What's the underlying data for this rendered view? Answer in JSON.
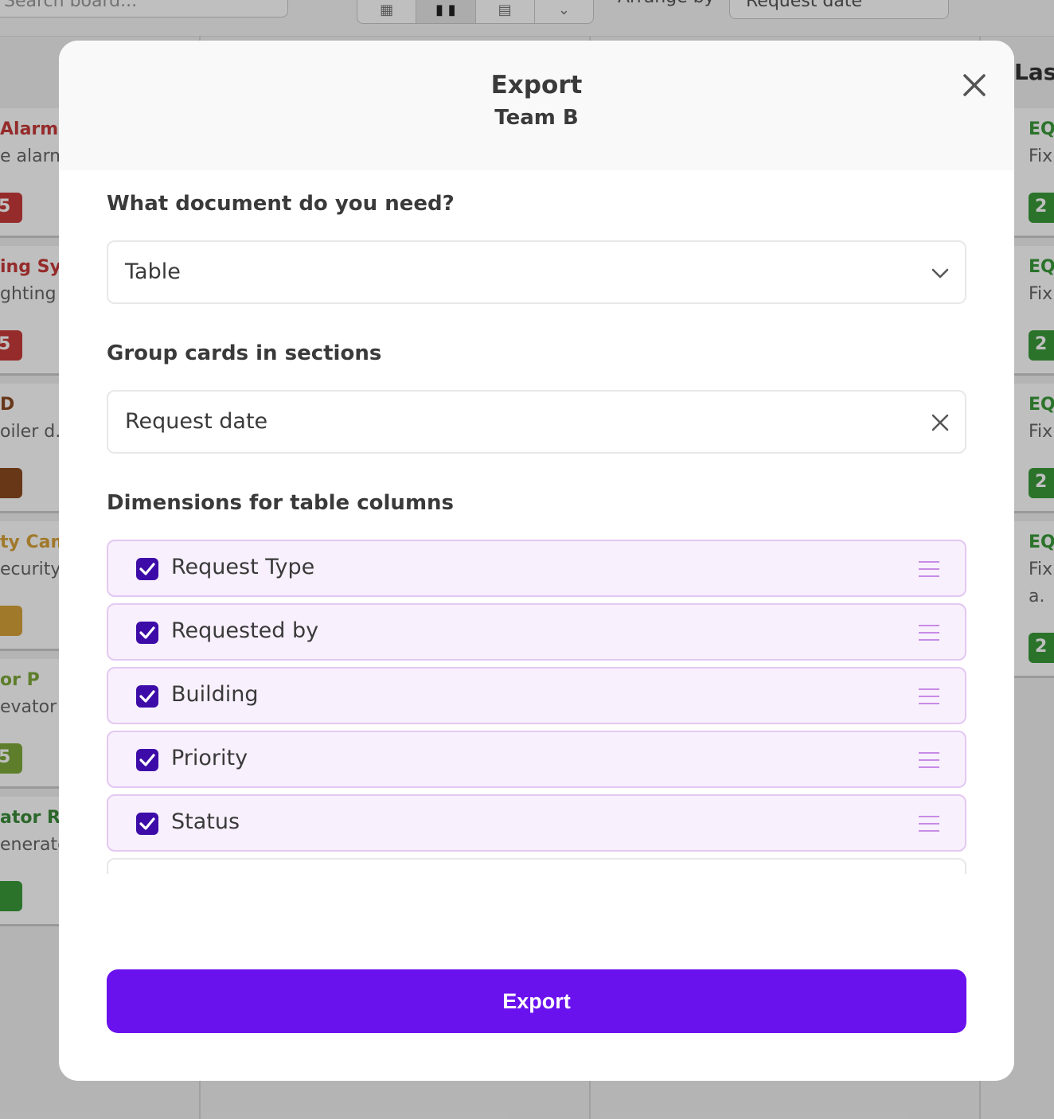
{
  "background": {
    "search_placeholder": "Search board...",
    "arrange_label": "Arrange by",
    "arrange_value": "Request date",
    "right_column_header": "Last",
    "left_cards": [
      {
        "title": "Alarm R",
        "sub": "e alarm",
        "badge": "5",
        "title_color": "#c73a3a",
        "badge_color": "#c73a3a"
      },
      {
        "title": "ing Syst",
        "sub": "ghting s",
        "badge": "5",
        "title_color": "#c73a3a",
        "badge_color": "#c73a3a"
      },
      {
        "title": "D",
        "sub": "oiler d.",
        "badge": "",
        "title_color": "#8a4a20",
        "badge_color": "#8a4a20"
      },
      {
        "title": "ty Cam",
        "sub": "ecurity c",
        "badge": "",
        "title_color": "#d6a23a",
        "badge_color": "#d6a23a"
      },
      {
        "title": "or P",
        "sub": "evator p",
        "badge": "5",
        "title_color": "#7ea83a",
        "badge_color": "#7ea83a"
      },
      {
        "title": "ator R",
        "sub": "enerato",
        "badge": "",
        "title_color": "#3a8a3a",
        "badge_color": "#3a9a3a"
      }
    ],
    "right_cards": [
      {
        "title": "EQ",
        "sub": "Fix",
        "sub2": "",
        "badge": "2"
      },
      {
        "title": "EQ",
        "sub": "Fix",
        "sub2": "",
        "badge": "2"
      },
      {
        "title": "EQ",
        "sub": "Fix",
        "sub2": "",
        "badge": "2"
      },
      {
        "title": "EQ",
        "sub": "Fix",
        "sub2": "a.",
        "badge": "2"
      }
    ]
  },
  "modal": {
    "title": "Export",
    "subtitle": "Team B",
    "document_label": "What document do you need?",
    "document_value": "Table",
    "group_label": "Group cards in sections",
    "group_value": "Request date",
    "dimensions_label": "Dimensions for table columns",
    "dimensions": [
      {
        "label": "Request Type",
        "checked": true
      },
      {
        "label": "Requested by",
        "checked": true
      },
      {
        "label": "Building",
        "checked": true
      },
      {
        "label": "Priority",
        "checked": true
      },
      {
        "label": "Status",
        "checked": true
      }
    ],
    "export_button": "Export"
  },
  "colors": {
    "accent": "#6a12ee",
    "checkbox": "#3d0ca8",
    "row_bg": "#f8f0fd",
    "row_border": "#e4c8f2",
    "drag_handle": "#c78be6"
  }
}
